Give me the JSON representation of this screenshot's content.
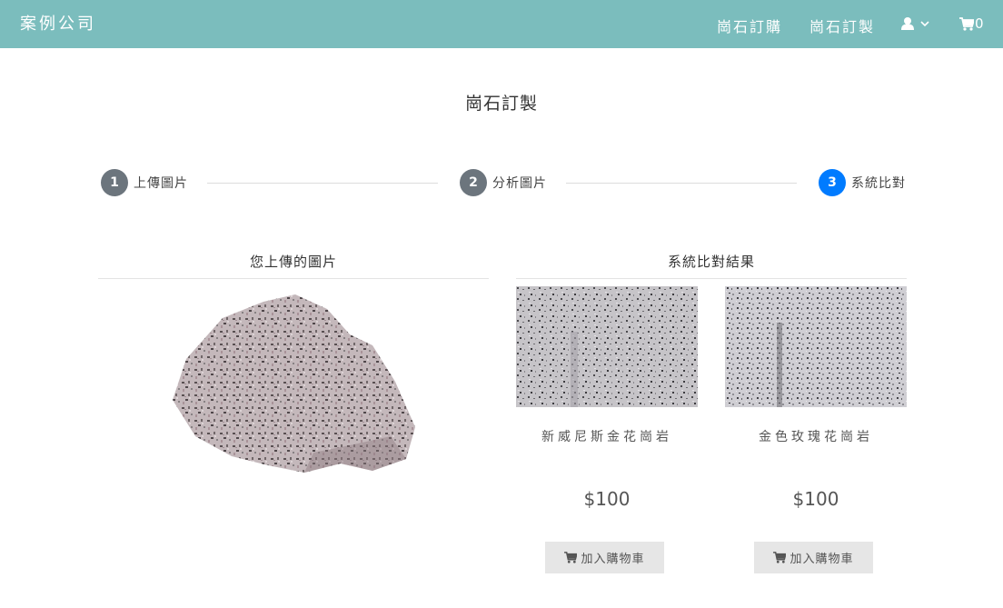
{
  "navbar": {
    "brand": "案例公司",
    "links": [
      "崗石訂購",
      "崗石訂製"
    ],
    "user_icon": "user-icon",
    "cart_count": "0",
    "bg_color": "#7bbdbd"
  },
  "page": {
    "title": "崗石訂製"
  },
  "stepper": {
    "steps": [
      {
        "number": "1",
        "label": "上傳圖片",
        "active": false
      },
      {
        "number": "2",
        "label": "分析圖片",
        "active": false
      },
      {
        "number": "3",
        "label": "系統比對",
        "active": true
      }
    ],
    "active_color": "#007bff",
    "inactive_color": "#6c757d"
  },
  "upload": {
    "heading": "您上傳的圖片"
  },
  "results": {
    "heading": "系統比對結果",
    "products": [
      {
        "name": "新威尼斯金花崗岩",
        "price": "$100",
        "button": "加入購物車"
      },
      {
        "name": "金色玫瑰花崗岩",
        "price": "$100",
        "button": "加入購物車"
      }
    ]
  }
}
